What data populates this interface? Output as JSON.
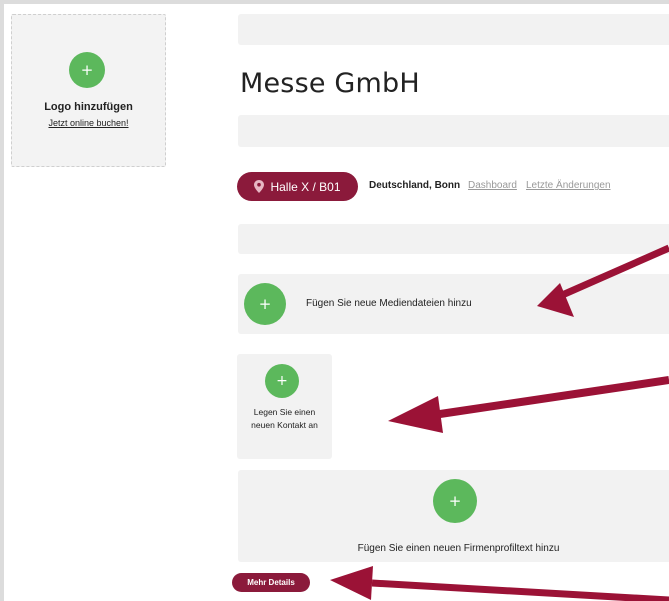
{
  "logo": {
    "title": "Logo hinzufügen",
    "link": "Jetzt online buchen!"
  },
  "company": {
    "name": "Messe GmbH"
  },
  "location": {
    "hall": "Halle X / B01",
    "place": "Deutschland, Bonn"
  },
  "links": {
    "dashboard": "Dashboard",
    "changes": "Letzte Änderungen"
  },
  "media": {
    "label": "Fügen Sie neue Mediendateien hinzu"
  },
  "contact": {
    "label_line1": "Legen Sie einen",
    "label_line2": "neuen Kontakt an"
  },
  "profile": {
    "label": "Fügen Sie einen neuen Firmenprofiltext hinzu"
  },
  "details": {
    "label": "Mehr Details"
  },
  "icons": {
    "plus": "+",
    "add": "plus-icon",
    "pin": "map-pin-icon",
    "arrow": "arrow-annotation"
  },
  "colors": {
    "accent": "#8b1a3b",
    "add_button": "#5cb85c",
    "panel": "#f2f2f2"
  }
}
